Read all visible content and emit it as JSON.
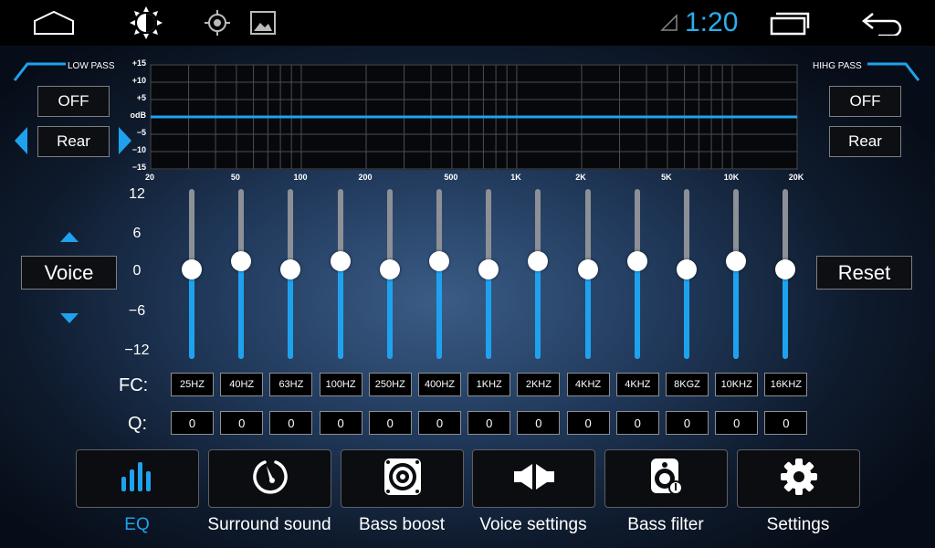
{
  "statusbar": {
    "time": "1:20",
    "icons": [
      "home-icon",
      "brightness-icon",
      "gps-icon",
      "gallery-icon",
      "signal-icon",
      "recent-apps-icon",
      "back-icon"
    ]
  },
  "low_pass": {
    "label": "LOW PASS",
    "state": "OFF",
    "channel": "Rear"
  },
  "high_pass": {
    "label": "HIHG PASS",
    "state": "OFF",
    "channel": "Rear"
  },
  "graph": {
    "y_labels": [
      "+15",
      "+10",
      "+5",
      "odB",
      "−5",
      "−10",
      "−15"
    ],
    "x_labels": [
      "20",
      "50",
      "100",
      "200",
      "500",
      "1K",
      "2K",
      "5K",
      "10K",
      "20K"
    ]
  },
  "scale": [
    "12",
    "6",
    "0",
    "−6",
    "−12"
  ],
  "voice_label": "Voice",
  "reset_label": "Reset",
  "fc_label": "FC:",
  "q_label": "Q:",
  "bands": [
    {
      "fc": "25HZ",
      "q": "0",
      "level": 0
    },
    {
      "fc": "40HZ",
      "q": "0",
      "level": -1
    },
    {
      "fc": "63HZ",
      "q": "0",
      "level": 0
    },
    {
      "fc": "100HZ",
      "q": "0",
      "level": -1
    },
    {
      "fc": "250HZ",
      "q": "0",
      "level": 0
    },
    {
      "fc": "400HZ",
      "q": "0",
      "level": -1
    },
    {
      "fc": "1KHZ",
      "q": "0",
      "level": 0
    },
    {
      "fc": "2KHZ",
      "q": "0",
      "level": -1
    },
    {
      "fc": "4KHZ",
      "q": "0",
      "level": 0
    },
    {
      "fc": "4KHZ",
      "q": "0",
      "level": -1
    },
    {
      "fc": "8KGZ",
      "q": "0",
      "level": 0
    },
    {
      "fc": "10KHZ",
      "q": "0",
      "level": -1
    },
    {
      "fc": "16KHZ",
      "q": "0",
      "level": 0
    }
  ],
  "nav": [
    {
      "label": "EQ",
      "icon": "equalizer-icon",
      "active": true
    },
    {
      "label": "Surround sound",
      "icon": "surround-dial-icon",
      "active": false
    },
    {
      "label": "Bass boost",
      "icon": "speaker-icon",
      "active": false
    },
    {
      "label": "Voice settings",
      "icon": "voice-settings-icon",
      "active": false
    },
    {
      "label": "Bass filter",
      "icon": "bass-filter-icon",
      "active": false
    },
    {
      "label": "Settings",
      "icon": "gear-icon",
      "active": false
    }
  ],
  "colors": {
    "accent": "#1fa2ee",
    "text": "#ffffff"
  }
}
